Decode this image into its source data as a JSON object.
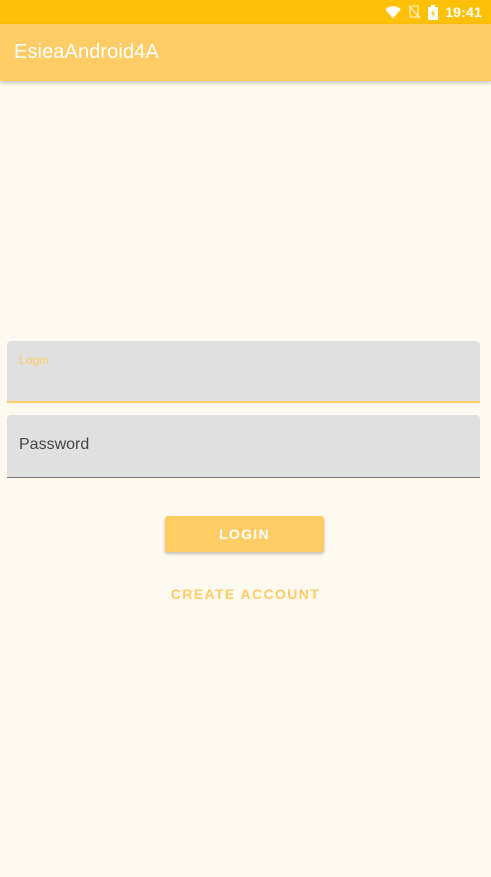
{
  "status_bar": {
    "time": "19:41",
    "icons": [
      "wifi-icon",
      "no-sim-icon",
      "battery-icon"
    ]
  },
  "app_bar": {
    "title": "EsieaAndroid4A"
  },
  "form": {
    "login_label": "Login",
    "password_hint": "Password",
    "login_button": "LOGIN",
    "create_account": "CREATE ACCOUNT"
  },
  "colors": {
    "status_bar": "#FFC107",
    "primary": "#FFCC66",
    "background": "#FFFAF0",
    "field_background": "#E0E0E0"
  }
}
